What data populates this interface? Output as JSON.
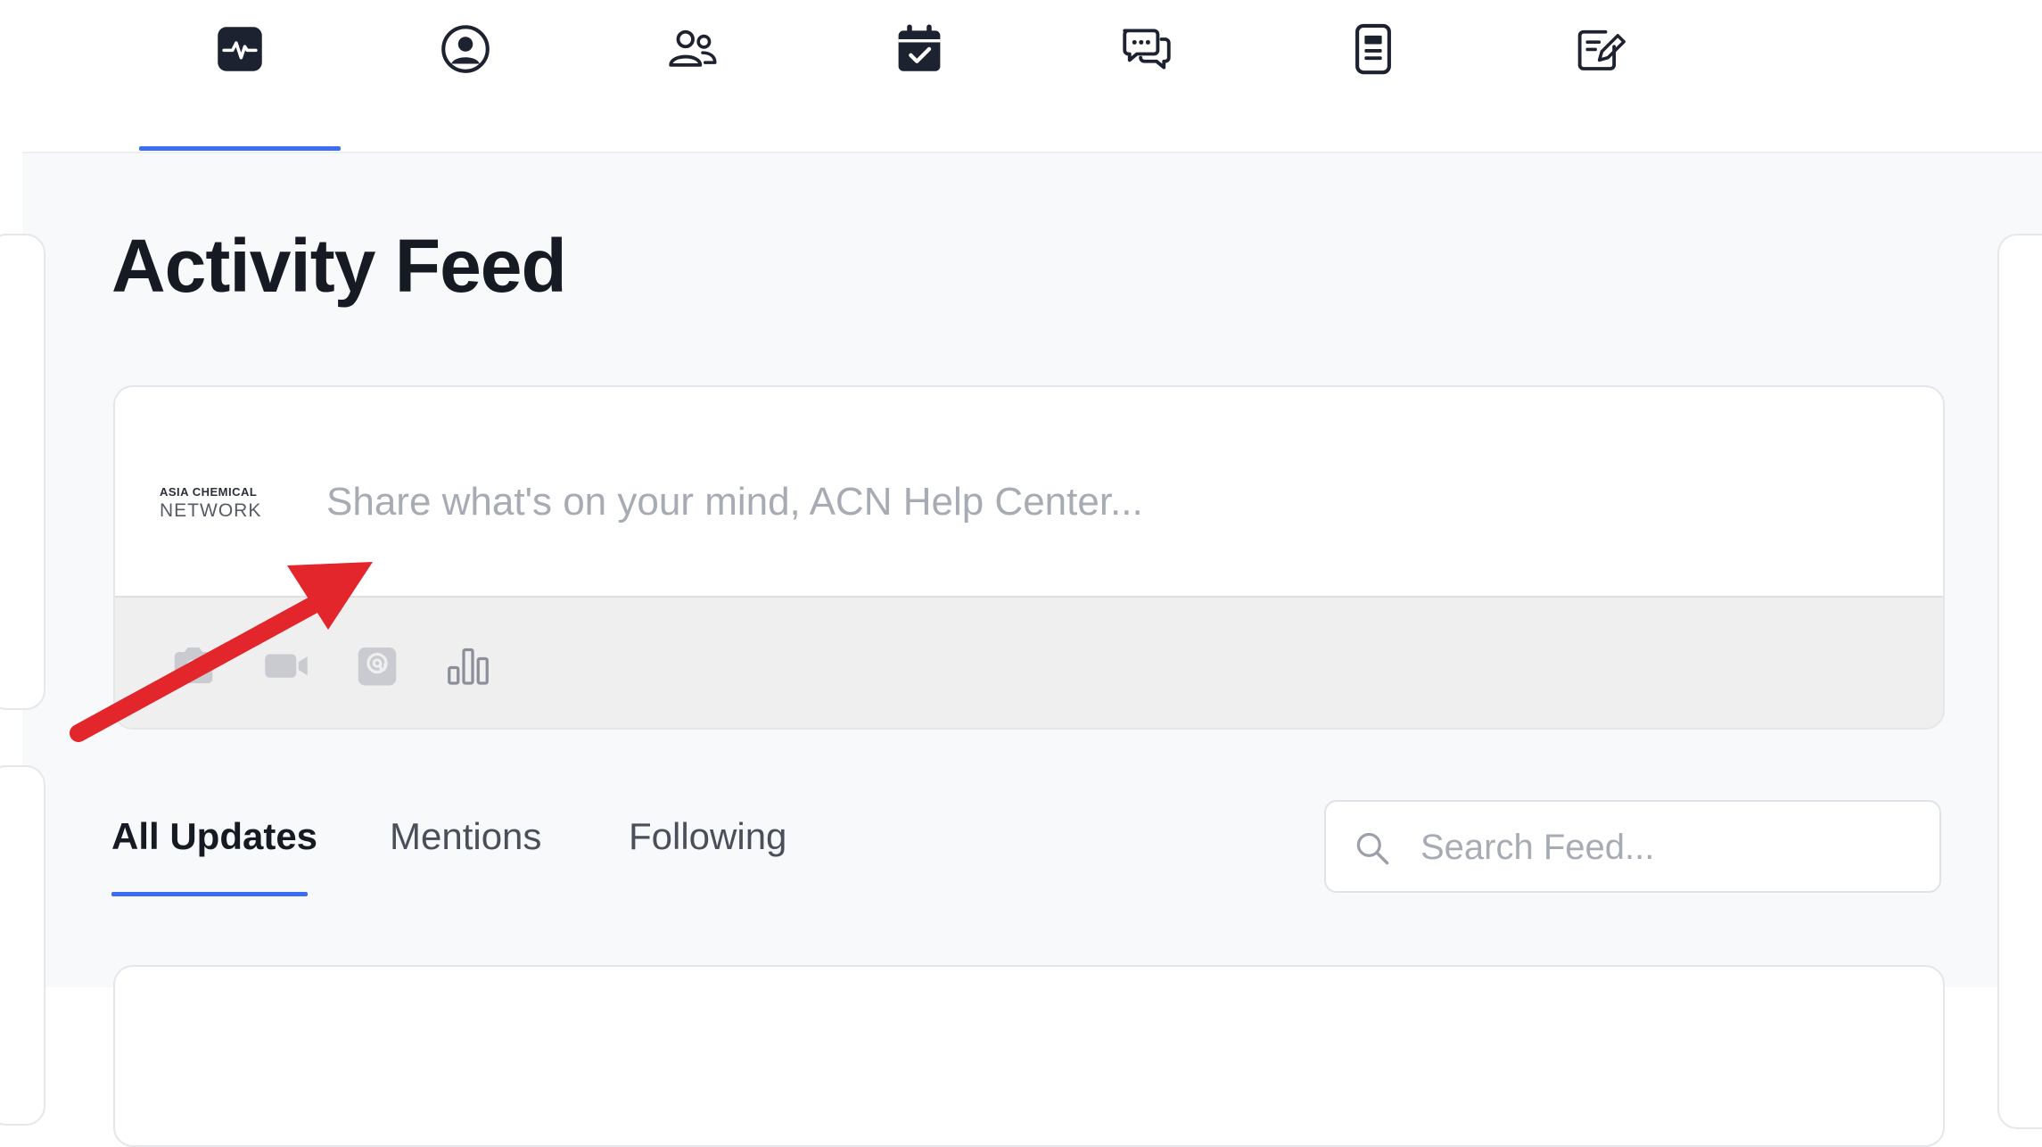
{
  "topnav": {
    "items": [
      {
        "id": "activity",
        "icon": "activity-pulse-icon",
        "active": true
      },
      {
        "id": "profile",
        "icon": "user-circle-icon",
        "active": false
      },
      {
        "id": "connections",
        "icon": "users-icon",
        "active": false
      },
      {
        "id": "events",
        "icon": "calendar-check-icon",
        "active": false
      },
      {
        "id": "messages",
        "icon": "chat-bubbles-icon",
        "active": false
      },
      {
        "id": "documents",
        "icon": "document-icon",
        "active": false
      },
      {
        "id": "forms",
        "icon": "edit-note-icon",
        "active": false
      }
    ],
    "accent_color": "#3b6cf6"
  },
  "page": {
    "title": "Activity Feed"
  },
  "composer": {
    "logo": {
      "line1": "ASIA CHEMICAL",
      "line2": "NETWORK"
    },
    "placeholder": "Share what's on your mind, ACN Help Center...",
    "tools": [
      "camera-icon",
      "video-icon",
      "attachment-icon",
      "poll-chart-icon"
    ]
  },
  "feed": {
    "tabs": [
      {
        "label": "All Updates",
        "active": true
      },
      {
        "label": "Mentions",
        "active": false
      },
      {
        "label": "Following",
        "active": false
      }
    ],
    "search_placeholder": "Search Feed..."
  },
  "annotation": {
    "arrow_color": "#e3262b"
  }
}
